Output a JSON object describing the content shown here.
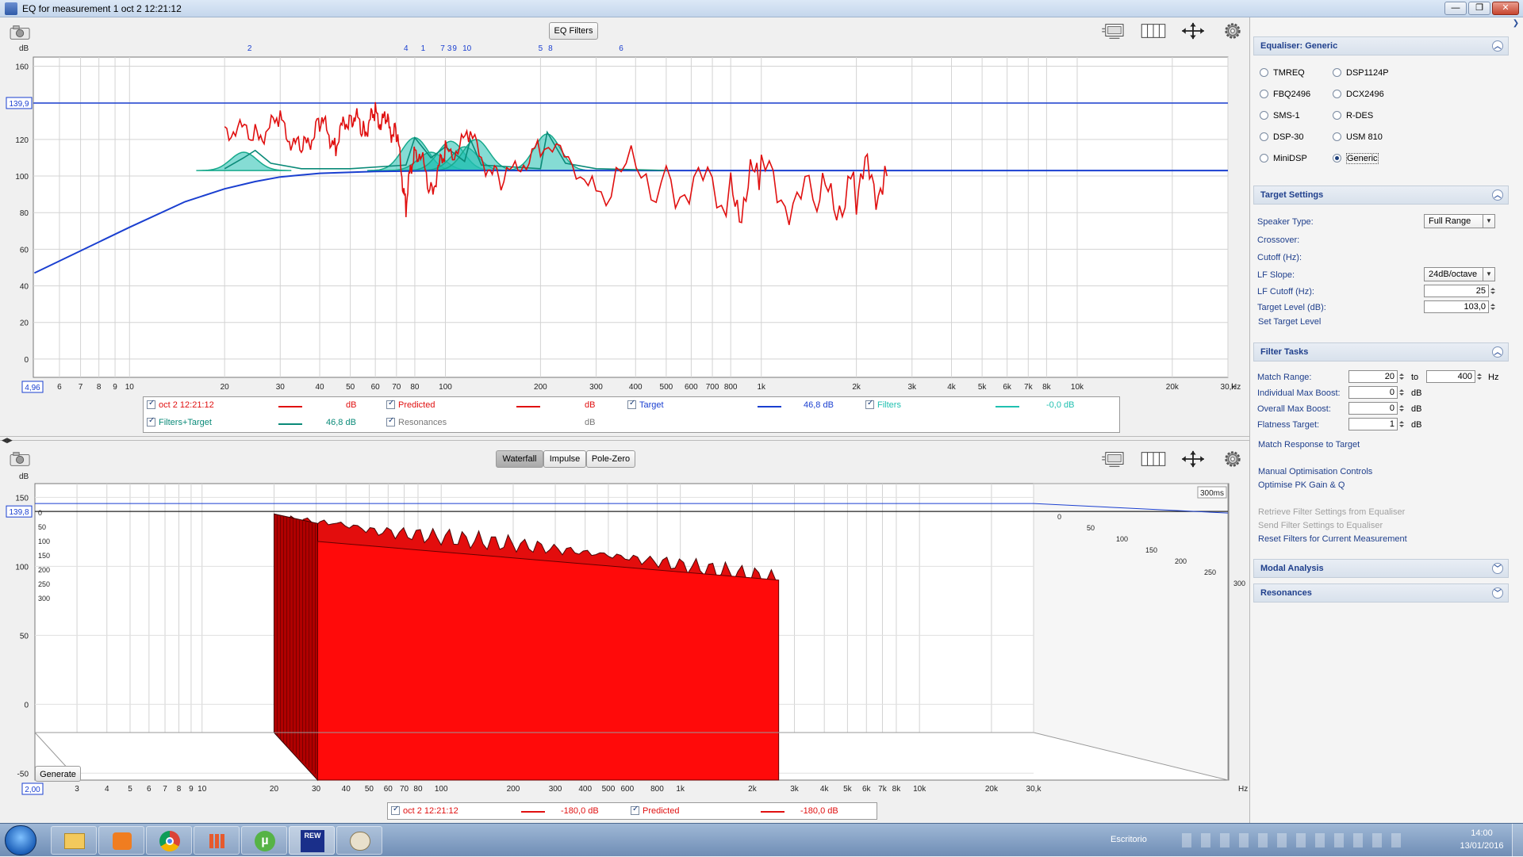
{
  "window": {
    "title": "EQ for measurement 1 oct 2 12:21:12",
    "controls": {
      "minimize": "—",
      "maximize": "❐",
      "close": "✕"
    }
  },
  "colors": {
    "measurement": "#e01010",
    "target": "#1a3fd0",
    "filters_target": "#0a8a78",
    "filters": "#20c0b0",
    "predicted": "#e01010",
    "accent": "#1f3f8c"
  },
  "top_plot": {
    "toolbar_button": "EQ Filters",
    "y_unit": "dB",
    "x_unit": "Hz",
    "y_cursor_value": "139,9",
    "x_cursor_value": "4,96",
    "filter_markers": [
      "2",
      "4",
      "1",
      "7",
      "3",
      "9",
      "10",
      "5",
      "8",
      "6"
    ],
    "legend": [
      {
        "label": "oct 2 12:21:12",
        "value": "dB",
        "checked": true,
        "color": "#e01010"
      },
      {
        "label": "Predicted",
        "value": "dB",
        "checked": true,
        "color": "#e01010"
      },
      {
        "label": "Target",
        "value": "46,8 dB",
        "checked": true,
        "color": "#1a3fd0"
      },
      {
        "label": "Filters",
        "value": "-0,0 dB",
        "checked": true,
        "color": "#20c0b0"
      },
      {
        "label": "Filters+Target",
        "value": "46,8 dB",
        "checked": true,
        "color": "#0a8a78"
      },
      {
        "label": "Resonances",
        "value": "dB",
        "checked": true,
        "color": "#666666"
      }
    ]
  },
  "bottom_plot": {
    "tabs": [
      "Waterfall",
      "Impulse",
      "Pole-Zero"
    ],
    "active_tab": "Waterfall",
    "y_unit": "dB",
    "x_unit": "Hz",
    "y_cursor_value": "139,8",
    "x_cursor_value": "2,00",
    "time_label": "300ms",
    "generate_button": "Generate",
    "legend": [
      {
        "label": "oct 2 12:21:12",
        "value": "-180,0 dB",
        "checked": true,
        "color": "#e01010"
      },
      {
        "label": "Predicted",
        "value": "-180,0 dB",
        "checked": true,
        "color": "#e01010"
      }
    ]
  },
  "chart_data": [
    {
      "type": "line",
      "title": "",
      "xlabel": "Hz",
      "ylabel": "dB",
      "xscale": "log",
      "xlim": [
        4.96,
        30000
      ],
      "ylim": [
        -10,
        165
      ],
      "x_ticks": [
        "6",
        "7",
        "8",
        "9",
        "10",
        "20",
        "30",
        "40",
        "50",
        "60",
        "70",
        "80",
        "100",
        "200",
        "300",
        "400",
        "500",
        "600",
        "700",
        "800",
        "1k",
        "2k",
        "3k",
        "4k",
        "5k",
        "6k",
        "7k",
        "8k",
        "10k",
        "20k",
        "30,k"
      ],
      "y_ticks": [
        "160",
        "140",
        "120",
        "100",
        "80",
        "60",
        "40",
        "20",
        "0"
      ],
      "grid": true,
      "series": [
        {
          "name": "Target",
          "x": [
            5,
            10,
            15,
            20,
            25,
            30,
            40,
            60,
            100,
            1000,
            10000,
            30000
          ],
          "y": [
            47,
            72,
            86,
            93,
            97,
            99.5,
            101.5,
            102.5,
            103,
            103,
            103,
            103
          ]
        },
        {
          "name": "Filters+Target",
          "x": [
            20,
            23,
            25,
            28,
            35,
            50,
            75,
            80,
            90,
            100,
            115,
            120,
            130,
            200,
            210,
            240,
            300,
            500
          ],
          "y": [
            104,
            110,
            114,
            107,
            104,
            104,
            106,
            121,
            110,
            116,
            108,
            120,
            106,
            104,
            124,
            107,
            104,
            103
          ]
        },
        {
          "name": "oct 2 12:21:12",
          "x": [
            20,
            25,
            30,
            35,
            40,
            45,
            50,
            55,
            60,
            65,
            70,
            75,
            80,
            90,
            100,
            120,
            150,
            200,
            300,
            500,
            800,
            1000,
            1500,
            2000,
            2500
          ],
          "y": [
            127,
            122,
            129,
            112,
            130,
            118,
            135,
            125,
            133,
            128,
            123,
            85,
            118,
            93,
            112,
            120,
            95,
            118,
            97,
            101,
            85,
            98,
            83,
            95,
            100
          ]
        }
      ]
    },
    {
      "type": "area",
      "title": "",
      "xlabel": "Hz",
      "ylabel": "dB",
      "xscale": "log",
      "xlim": [
        2,
        30000
      ],
      "ylim": [
        -55,
        160
      ],
      "x_ticks": [
        "3",
        "4",
        "5",
        "6",
        "7",
        "8",
        "9",
        "10",
        "20",
        "30",
        "40",
        "50",
        "60",
        "70",
        "80",
        "100",
        "200",
        "300",
        "400",
        "500",
        "600",
        "800",
        "1k",
        "2k",
        "3k",
        "4k",
        "5k",
        "6k",
        "7k",
        "8k",
        "10k",
        "20k",
        "30,k"
      ],
      "y_ticks": [
        "150",
        "100",
        "50",
        "0",
        "-50"
      ],
      "time_slices_ms": [
        "0",
        "50",
        "100",
        "150",
        "200",
        "250",
        "300"
      ],
      "series": [
        {
          "name": "oct 2 12:21:12",
          "x": [
            20,
            30,
            40,
            50,
            100,
            200,
            500,
            1000,
            2500
          ],
          "y": [
            138,
            136,
            134,
            130,
            125,
            120,
            112,
            105,
            95
          ]
        }
      ]
    }
  ],
  "sidebar": {
    "equaliser": {
      "heading": "Equaliser: Generic",
      "options_left": [
        "TMREQ",
        "FBQ2496",
        "SMS-1",
        "DSP-30",
        "MiniDSP"
      ],
      "options_right": [
        "DSP1124P",
        "DCX2496",
        "R-DES",
        "USM 810",
        "Generic"
      ],
      "selected": "Generic"
    },
    "target": {
      "heading": "Target Settings",
      "speaker_type_label": "Speaker Type:",
      "speaker_type_value": "Full Range",
      "crossover_label": "Crossover:",
      "cutoff_label": "Cutoff (Hz):",
      "lf_slope_label": "LF Slope:",
      "lf_slope_value": "24dB/octave",
      "lf_cutoff_label": "LF Cutoff (Hz):",
      "lf_cutoff_value": "25",
      "target_level_label": "Target Level (dB):",
      "target_level_value": "103,0",
      "set_target_link": "Set Target Level"
    },
    "filter_tasks": {
      "heading": "Filter Tasks",
      "match_range_label": "Match Range:",
      "match_from": "20",
      "to_label": "to",
      "match_to": "400",
      "hz_label": "Hz",
      "indiv_boost_label": "Individual Max Boost:",
      "indiv_boost_value": "0",
      "overall_boost_label": "Overall Max Boost:",
      "overall_boost_value": "0",
      "flatness_label": "Flatness Target:",
      "flatness_value": "1",
      "db_label": "dB",
      "match_link": "Match Response to Target",
      "manual_link": "Manual Optimisation Controls",
      "optimise_link": "Optimise PK Gain & Q",
      "retrieve_link": "Retrieve Filter Settings from Equaliser",
      "send_link": "Send Filter Settings to Equaliser",
      "reset_link": "Reset Filters for Current Measurement"
    },
    "modal_heading": "Modal Analysis",
    "resonances_heading": "Resonances"
  },
  "taskbar": {
    "desktop_label": "Escritorio",
    "time": "14:00",
    "date": "13/01/2016"
  }
}
